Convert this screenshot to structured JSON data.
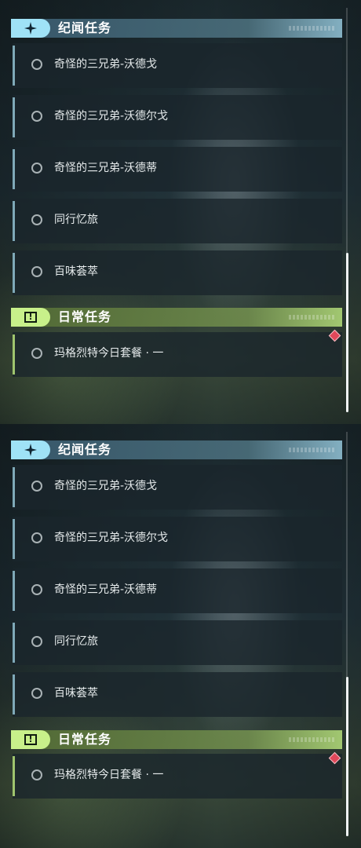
{
  "sections": {
    "story": {
      "title": "纪闻任务",
      "icon": "sparkle-star-icon",
      "accent_color": "#9fe2f6",
      "quests": [
        {
          "label": "奇怪的三兄弟-沃德戈"
        },
        {
          "label": "奇怪的三兄弟-沃德尔戈"
        },
        {
          "label": "奇怪的三兄弟-沃德蒂"
        },
        {
          "label": "同行忆旅"
        },
        {
          "label": "百味荟萃"
        }
      ]
    },
    "daily": {
      "title": "日常任务",
      "icon": "alert-exclamation-icon",
      "accent_color": "#c8f08a",
      "quests": [
        {
          "label": "玛格烈特今日套餐 · 一",
          "marker": "red-diamond-icon"
        }
      ]
    }
  },
  "colors": {
    "marker": "#e0485a",
    "scrollbar_thumb": "#f0f4f5"
  }
}
